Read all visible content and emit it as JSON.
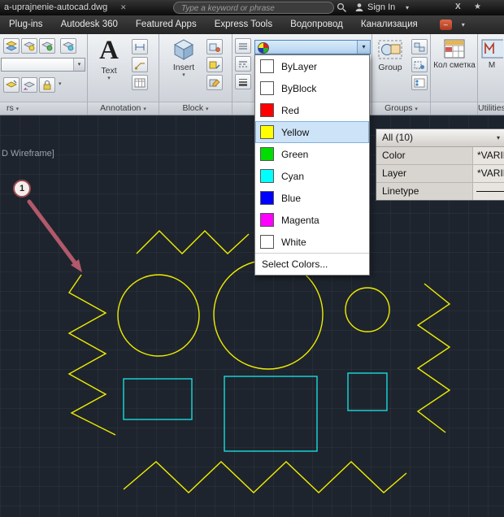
{
  "titlebar": {
    "filename": "a-uprajnenie-autocad.dwg",
    "search_placeholder": "Type a keyword or phrase",
    "signin": "Sign In"
  },
  "icons": {
    "caret_down": "▾",
    "close": "✕",
    "star": "★",
    "minus": "–",
    "x_app": "X"
  },
  "menubar": {
    "tabs": [
      {
        "label": "Plug-ins"
      },
      {
        "label": "Autodesk 360"
      },
      {
        "label": "Featured Apps"
      },
      {
        "label": "Express Tools"
      },
      {
        "label": "Водопровод"
      },
      {
        "label": "Канализация"
      }
    ]
  },
  "ribbon": {
    "layers_panel": {
      "label": "rs"
    },
    "annotation_panel": {
      "label": "Annotation",
      "big_letter": "A",
      "text_label": "Text"
    },
    "block_panel": {
      "label": "Block",
      "insert_label": "Insert"
    },
    "groups_panel": {
      "label": "Groups",
      "group_label": "Group"
    },
    "utilities_panel": {
      "label": "Utilities",
      "kol_smetka_label": "Кол сметка",
      "m_label": "М"
    }
  },
  "color_dropdown": {
    "items": [
      {
        "label": "ByLayer",
        "swatch": "#ffffff"
      },
      {
        "label": "ByBlock",
        "swatch": "#ffffff"
      },
      {
        "label": "Red",
        "swatch": "#ff0000"
      },
      {
        "label": "Yellow",
        "swatch": "#ffff00"
      },
      {
        "label": "Green",
        "swatch": "#00dd00"
      },
      {
        "label": "Cyan",
        "swatch": "#00ffff"
      },
      {
        "label": "Blue",
        "swatch": "#0000ff"
      },
      {
        "label": "Magenta",
        "swatch": "#ff00ff"
      },
      {
        "label": "White",
        "swatch": "#ffffff"
      }
    ],
    "footer": "Select Colors..."
  },
  "properties_panel": {
    "header": "All (10)",
    "rows": [
      {
        "label": "Color",
        "value": "*VARIE"
      },
      {
        "label": "Layer",
        "value": "*VARIE"
      },
      {
        "label": "Linetype",
        "value": ""
      }
    ]
  },
  "canvas": {
    "viewport_label": "D Wireframe]",
    "badge": "1",
    "colors": {
      "yellow": "#ededU00",
      "cyan": "#17dcdc",
      "arrow": "#b2596b"
    }
  }
}
